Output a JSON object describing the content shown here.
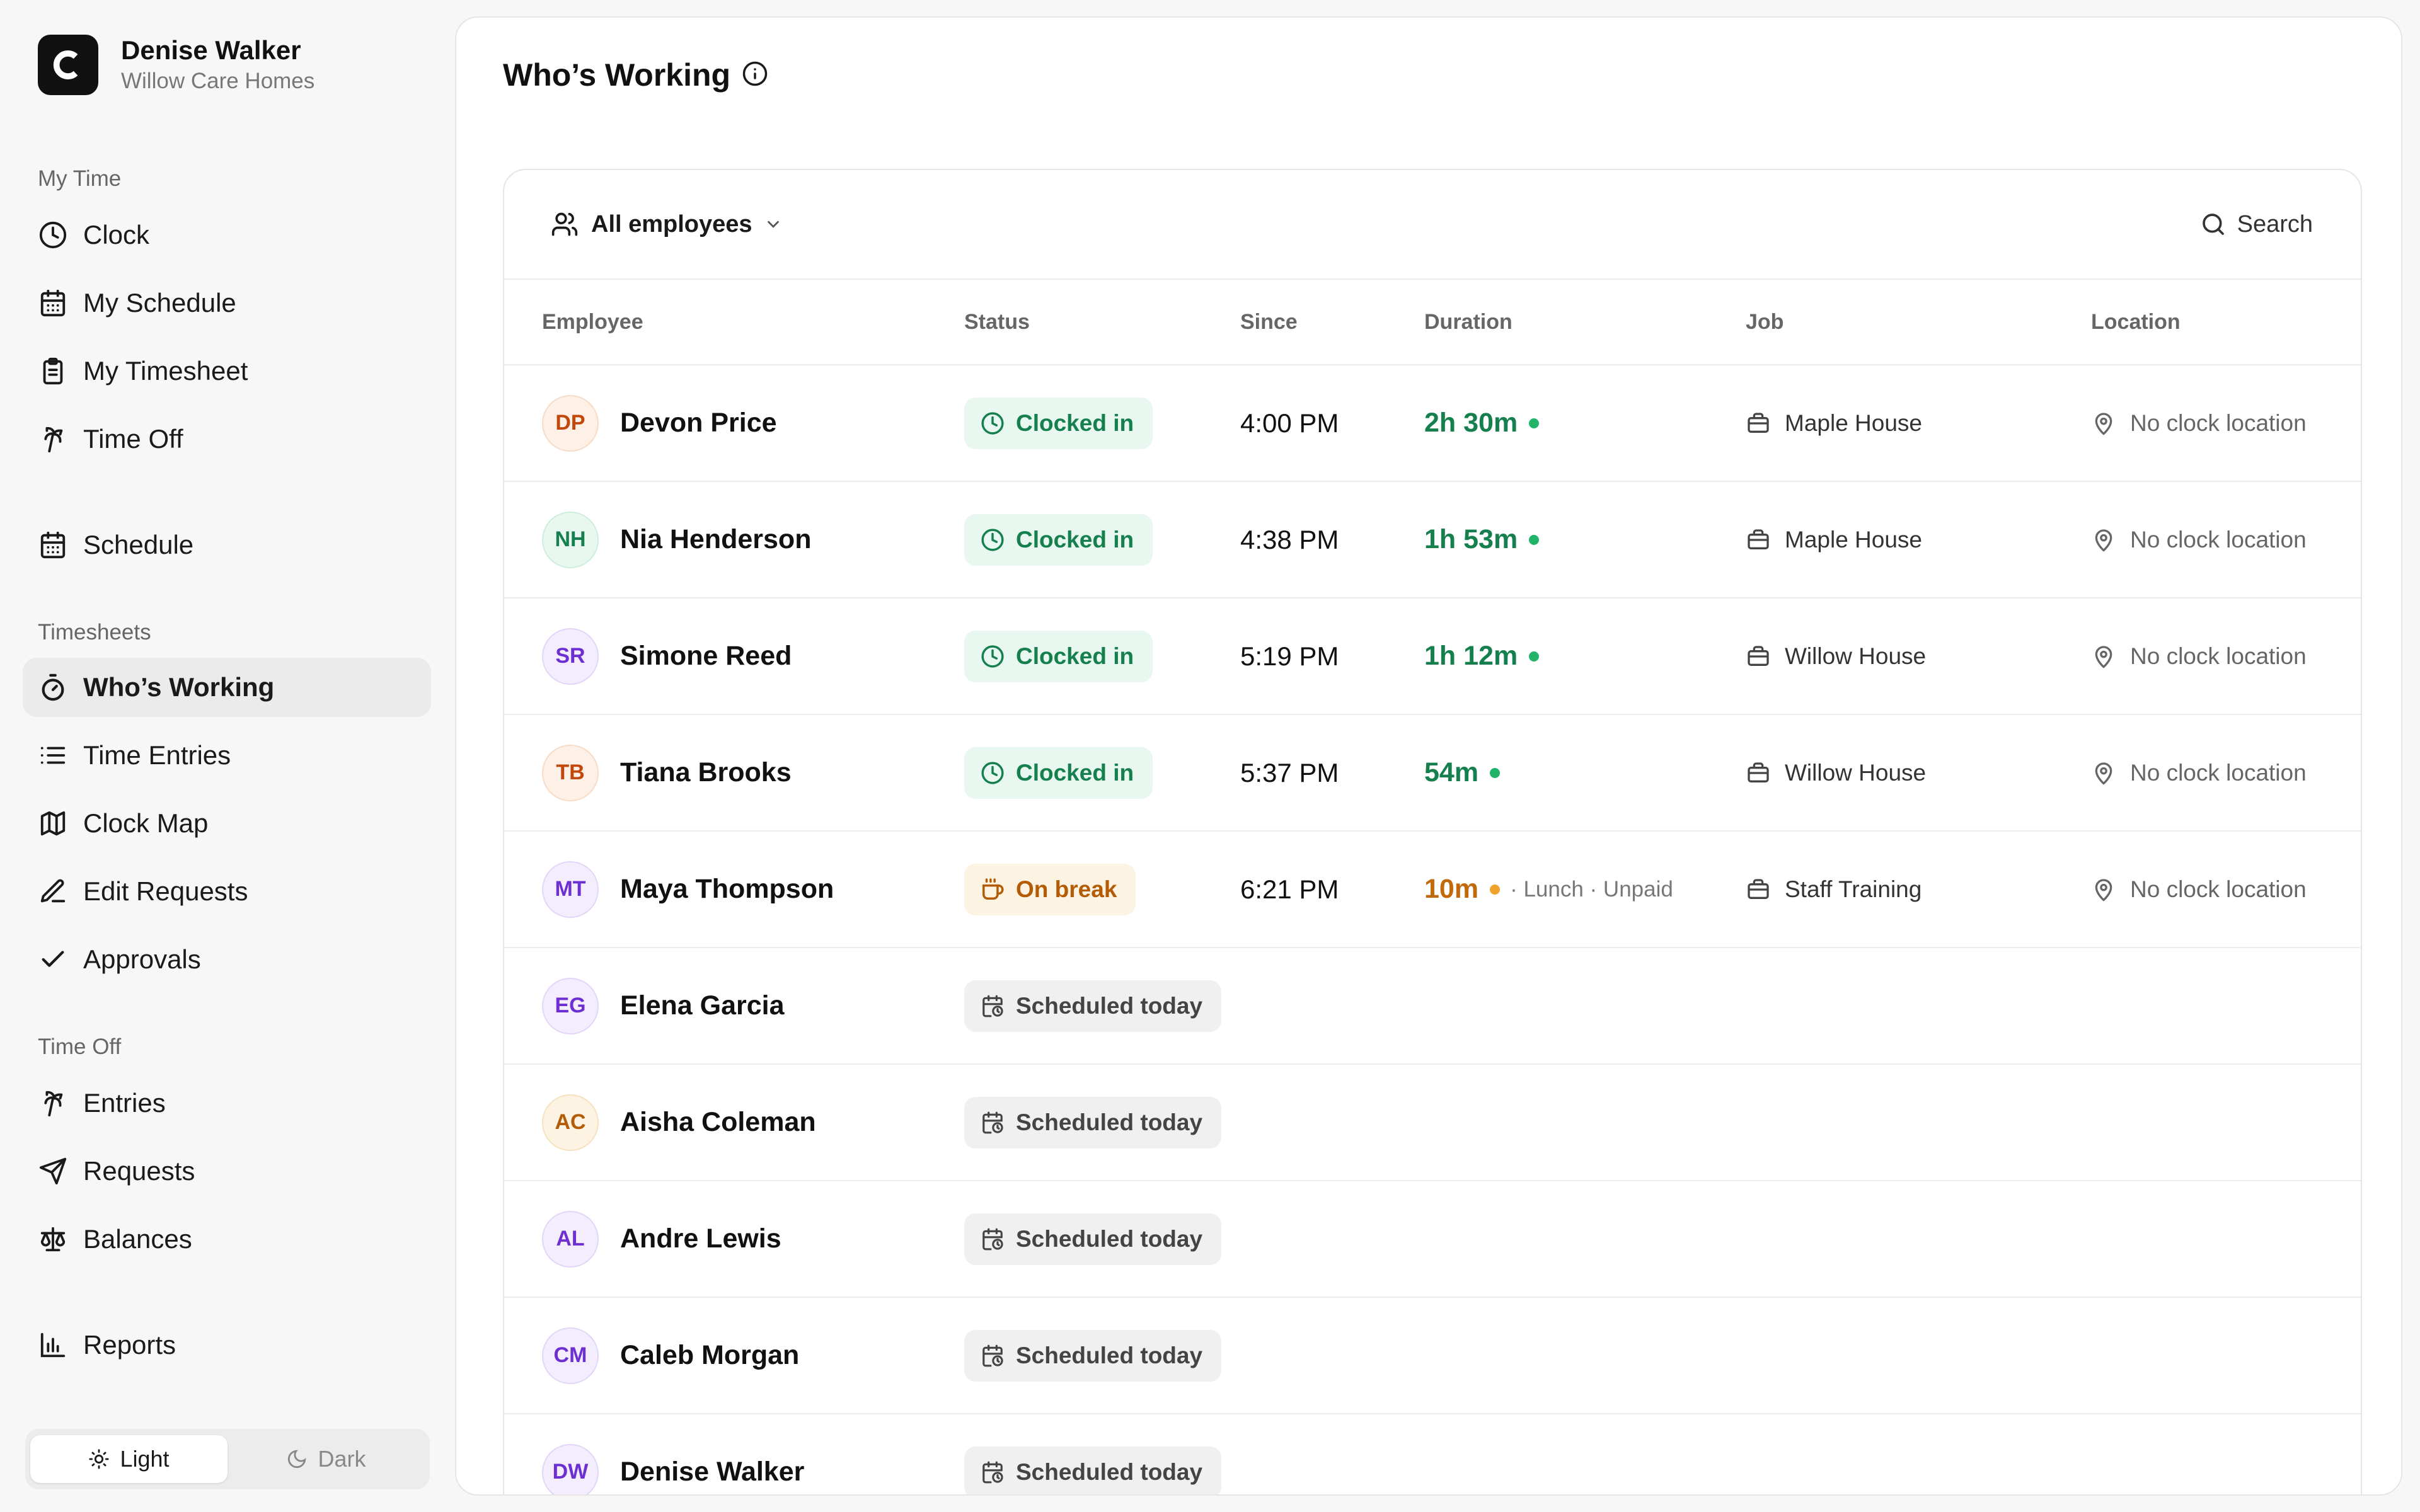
{
  "brand": {
    "name": "Denise Walker",
    "org": "Willow Care Homes"
  },
  "sidebar": {
    "section_my_time": "My Time",
    "clock": "Clock",
    "my_schedule": "My Schedule",
    "my_timesheet": "My Timesheet",
    "time_off": "Time Off",
    "schedule": "Schedule",
    "section_timesheets": "Timesheets",
    "whos_working": "Who’s Working",
    "time_entries": "Time Entries",
    "clock_map": "Clock Map",
    "edit_requests": "Edit Requests",
    "approvals": "Approvals",
    "section_time_off": "Time Off",
    "entries": "Entries",
    "requests": "Requests",
    "balances": "Balances",
    "reports": "Reports"
  },
  "theme": {
    "light": "Light",
    "dark": "Dark",
    "selected": "Light"
  },
  "page": {
    "title": "Who’s Working"
  },
  "toolbar": {
    "filter_label": "All employees",
    "search_label": "Search"
  },
  "columns": {
    "employee": "Employee",
    "status": "Status",
    "since": "Since",
    "duration": "Duration",
    "job": "Job",
    "location": "Location"
  },
  "rows": [
    {
      "initials": "DP",
      "name": "Devon Price",
      "status": "Clocked in",
      "since": "4:00 PM",
      "duration": "2h 30m",
      "note": "",
      "job": "Maple House",
      "location": "No clock location"
    },
    {
      "initials": "NH",
      "name": "Nia Henderson",
      "status": "Clocked in",
      "since": "4:38 PM",
      "duration": "1h 53m",
      "note": "",
      "job": "Maple House",
      "location": "No clock location"
    },
    {
      "initials": "SR",
      "name": "Simone Reed",
      "status": "Clocked in",
      "since": "5:19 PM",
      "duration": "1h 12m",
      "note": "",
      "job": "Willow House",
      "location": "No clock location"
    },
    {
      "initials": "TB",
      "name": "Tiana Brooks",
      "status": "Clocked in",
      "since": "5:37 PM",
      "duration": "54m",
      "note": "",
      "job": "Willow House",
      "location": "No clock location"
    },
    {
      "initials": "MT",
      "name": "Maya Thompson",
      "status": "On break",
      "since": "6:21 PM",
      "duration": "10m",
      "note": "· Lunch · Unpaid",
      "job": "Staff Training",
      "location": "No clock location"
    },
    {
      "initials": "EG",
      "name": "Elena Garcia",
      "status": "Scheduled today"
    },
    {
      "initials": "AC",
      "name": "Aisha Coleman",
      "status": "Scheduled today"
    },
    {
      "initials": "AL",
      "name": "Andre Lewis",
      "status": "Scheduled today"
    },
    {
      "initials": "CM",
      "name": "Caleb Morgan",
      "status": "Scheduled today"
    },
    {
      "initials": "DW",
      "name": "Denise Walker",
      "status": "Scheduled today"
    }
  ]
}
